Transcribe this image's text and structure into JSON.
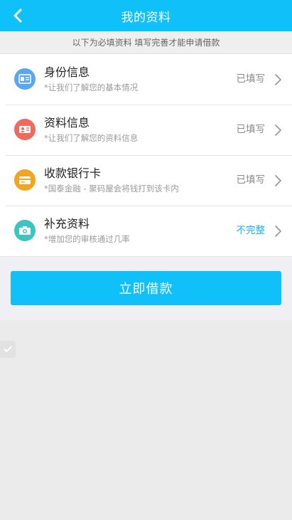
{
  "header": {
    "title": "我的资料",
    "back_icon": "chevron-left-icon"
  },
  "notice": "以下为必填资料 填写完善才能申请借款",
  "items": [
    {
      "title": "身份信息",
      "subtitle": "*让我们了解您的基本情况",
      "status": "已填写",
      "icon": "id-card-icon",
      "icon_color": "#5aa7f0"
    },
    {
      "title": "资料信息",
      "subtitle": "*让我们了解您的资料信息",
      "status": "已填写",
      "icon": "profile-card-icon",
      "icon_color": "#ef6a5c"
    },
    {
      "title": "收款银行卡",
      "subtitle": "*国泰金融 - 聚码屋会将钱打到该卡内",
      "status": "已填写",
      "icon": "bank-card-icon",
      "icon_color": "#f4a51f"
    },
    {
      "title": "补充资料",
      "subtitle": "*增加您的审核通过几率",
      "status": "不完整",
      "icon": "camera-icon",
      "icon_color": "#3cc4c0"
    }
  ],
  "apply_button": "立即借款",
  "colors": {
    "accent": "#0fc0f9",
    "incomplete": "#14b5ea",
    "background": "#efeff4"
  }
}
